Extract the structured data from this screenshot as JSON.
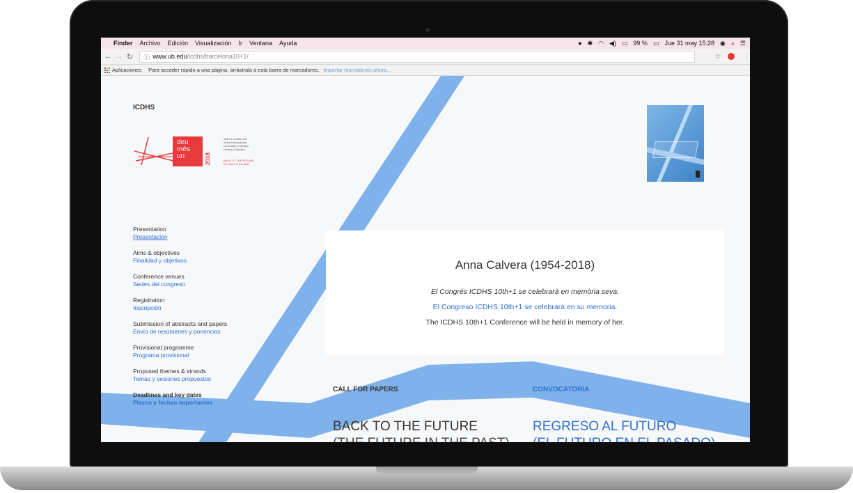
{
  "menubar": {
    "items": [
      "Finder",
      "Archivo",
      "Edición",
      "Visualización",
      "Ir",
      "Ventana",
      "Ayuda"
    ],
    "battery": "99 %",
    "clock": "Jue 31 may  15:28"
  },
  "browser": {
    "url_host": "www.ub.edu",
    "url_path": "/icdhs/barcelona10+1/",
    "bookmarks": {
      "apps_label": "Aplicaciones",
      "hint": "Para acceder rápido a una página, arrástrala a esta barra de marcadores.",
      "import_link": "Importar marcadores ahora..."
    }
  },
  "page": {
    "brand": "ICDHS",
    "logo": {
      "line1": "deu",
      "line2": "més",
      "line3": "un",
      "year": "2018",
      "desc1": "10th+1 Conference",
      "desc2": "of the International",
      "desc3": "committee of design",
      "desc4": "History & Studies",
      "tag1": "BACK TO THE FUTURE",
      "tag2": "the future in the past"
    },
    "nav": [
      {
        "en": "Presentation",
        "es": "Presentación"
      },
      {
        "en": "Aims & objectives",
        "es": "Finalidad y objetivos"
      },
      {
        "en": "Conference venues",
        "es": "Sedes del congreso"
      },
      {
        "en": "Registration",
        "es": "Inscripción"
      },
      {
        "en": "Submission of abstracts and papers",
        "es": "Envío de resúmenes y ponencias"
      },
      {
        "en": "Provisional programme",
        "es": "Programa provisional"
      },
      {
        "en": "Proposed themes & strands",
        "es": "Temas y sesiones propuestos"
      },
      {
        "en": "Deadlines and key dates",
        "es": "Plazos y fechas importantes"
      }
    ],
    "memorial": {
      "title": "Anna Calvera (1954-2018)",
      "ca": "El Congrés ICDHS 10th+1 se celebrarà en memòria seva.",
      "es": "El Congreso ICDHS 10th+1 se celebrará en su memoria.",
      "en": "The ICDHS 10th+1 Conference will be held in memory of her."
    },
    "call_for_papers_en": "CALL FOR PAPERS",
    "call_for_papers_es": "CONVOCATORIA",
    "headline_en": "BACK TO THE FUTURE",
    "headline_en_sub": "(THE FUTURE IN THE PAST)",
    "headline_es": "REGRESO AL FUTURO",
    "headline_es_sub": "(EL FUTURO EN EL PASADO)"
  },
  "colors": {
    "accent_blue": "#2d6fd1",
    "stripe_blue": "#7fb2ea",
    "logo_red": "#e63a3c"
  }
}
